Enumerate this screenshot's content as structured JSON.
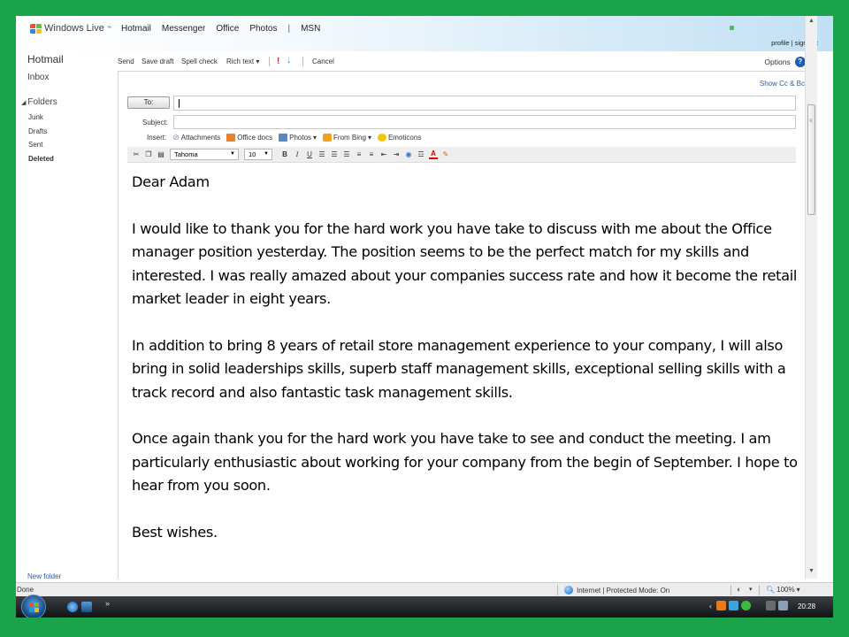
{
  "header": {
    "brand": "Windows Live",
    "brand_tm": "™",
    "nav": [
      "Hotmail",
      "Messenger",
      "Office",
      "Photos",
      "MSN"
    ],
    "nav_separator": "|",
    "profile_link": "profile",
    "signout_link": "sign out",
    "profile_separator": "|"
  },
  "sidebar": {
    "title": "Hotmail",
    "inbox": "Inbox",
    "folders_label": "Folders",
    "folders": [
      {
        "label": "Junk",
        "active": false
      },
      {
        "label": "Drafts",
        "active": false
      },
      {
        "label": "Sent",
        "active": false
      },
      {
        "label": "Deleted",
        "active": true
      }
    ],
    "new_folder": "New folder"
  },
  "actions": {
    "send": "Send",
    "save_draft": "Save draft",
    "spell_check": "Spell check",
    "rich_text": "Rich text",
    "rich_text_caret": "▾",
    "cancel": "Cancel",
    "options": "Options",
    "help": "?",
    "options_caret": "▾"
  },
  "compose": {
    "show_cc_bcc": "Show Cc & Bcc",
    "to_label": "To:",
    "to_value": "",
    "subject_label": "Subject:",
    "subject_value": "",
    "insert_label": "Insert:",
    "insert_items": [
      {
        "label": "Attachments",
        "icon": "paperclip-icon",
        "color": "#7a8fb0",
        "has_menu": false
      },
      {
        "label": "Office docs",
        "icon": "office-docs-icon",
        "color": "#e8832a",
        "has_menu": false
      },
      {
        "label": "Photos",
        "icon": "photos-icon",
        "color": "#5a86c2",
        "has_menu": true
      },
      {
        "label": "From Bing",
        "icon": "bing-icon",
        "color": "#f2a11d",
        "has_menu": true
      },
      {
        "label": "Emoticons",
        "icon": "emoticon-icon",
        "color": "#f5c400",
        "has_menu": false
      }
    ],
    "menu_caret": "▾",
    "format": {
      "font": "Tahoma",
      "size": "10",
      "bold": "B",
      "italic": "I",
      "underline": "U"
    },
    "body": [
      "Dear Adam",
      "I would like to thank you for the hard work you have take to discuss with me about the Office manager position yesterday. The position seems to be the perfect match for my skills and interested. I was really amazed about your companies success rate and how it become the retail market leader in eight years.",
      "In addition to bring 8 years of retail store management experience to your company, I will also bring in solid leaderships skills, superb staff management skills, exceptional selling skills with a track record and also fantastic task management skills.",
      "Once again thank you for the hard work you have take to see and conduct the meeting. I am particularly enthusiastic about working for your company from the begin of September. I hope to hear from you soon.",
      "Best wishes."
    ]
  },
  "statusbar": {
    "status": "Done",
    "zone": "Internet | Protected Mode: On",
    "zoom": "100%",
    "zoom_caret": "▾"
  },
  "taskbar": {
    "clock": "20:28",
    "more": "»",
    "tray_arrow": "‹"
  },
  "colors": {
    "border_green": "#1aa34a",
    "link_blue": "#2a5ca8"
  }
}
